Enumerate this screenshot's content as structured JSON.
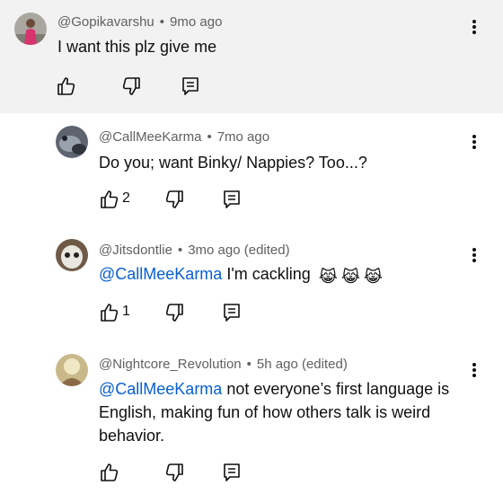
{
  "comments": [
    {
      "author": "@Gopikavarshu",
      "time": "9mo ago",
      "text": "I want this plz give me",
      "mention": "",
      "like_count": ""
    },
    {
      "author": "@CallMeeKarma",
      "time": "7mo ago",
      "text": "Do you; want Binky/ Nappies? Too...?",
      "mention": "",
      "like_count": "2"
    },
    {
      "author": "@Jitsdontlie",
      "time": "3mo ago (edited)",
      "mention": "@CallMeeKarma",
      "text": " I'm cackling",
      "emoji": [
        "😹",
        "😹",
        "😹"
      ],
      "like_count": "1"
    },
    {
      "author": "@Nightcore_Revolution",
      "time": "5h ago (edited)",
      "mention": "@CallMeeKarma",
      "text_line1": " not everyone’s first language is",
      "text_line2": "English, making fun of how others talk is weird",
      "text_line3": "behavior.",
      "like_count": ""
    }
  ],
  "separator": "•",
  "icons": {
    "like": "thumbs-up-icon",
    "dislike": "thumbs-down-icon",
    "reply": "reply-comment-icon",
    "more": "more-vertical-icon"
  },
  "colors": {
    "mention": "#065fd4",
    "meta": "#606060",
    "highlight_bg": "#f2f2f2"
  }
}
